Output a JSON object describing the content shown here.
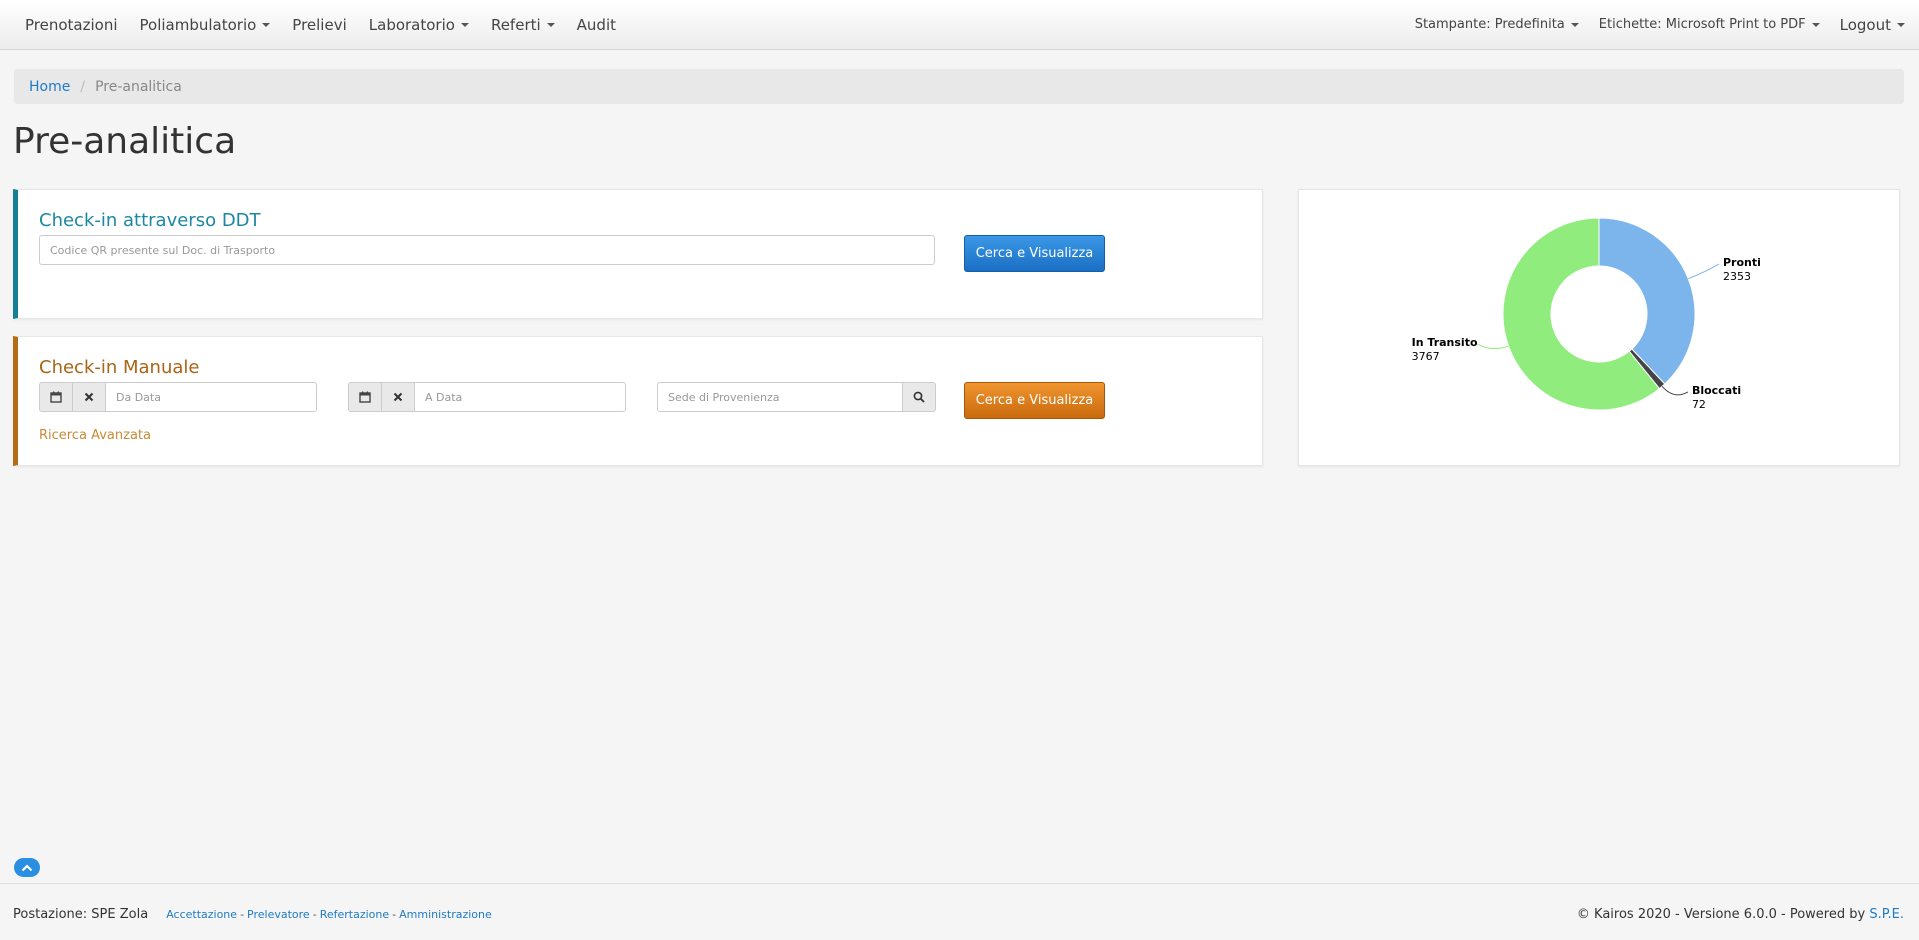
{
  "navbar": {
    "left": [
      {
        "label": "Prenotazioni",
        "dropdown": false
      },
      {
        "label": "Poliambulatorio",
        "dropdown": true
      },
      {
        "label": "Prelievi",
        "dropdown": false
      },
      {
        "label": "Laboratorio",
        "dropdown": true
      },
      {
        "label": "Referti",
        "dropdown": true
      },
      {
        "label": "Audit",
        "dropdown": false
      }
    ],
    "printer": "Stampante: Predefinita",
    "labels": "Etichette: Microsoft Print to PDF",
    "logout": "Logout"
  },
  "breadcrumb": {
    "home": "Home",
    "current": "Pre-analitica"
  },
  "page_title": "Pre-analitica",
  "ddt": {
    "title": "Check-in attraverso DDT",
    "placeholder": "Codice QR presente sul Doc. di Trasporto",
    "button": "Cerca e Visualizza"
  },
  "manual": {
    "title": "Check-in Manuale",
    "from_placeholder": "Da Data",
    "to_placeholder": "A Data",
    "sede_placeholder": "Sede di Provenienza",
    "button": "Cerca e Visualizza",
    "advanced": "Ricerca Avanzata",
    "icons": {
      "calendar": "calendar-icon",
      "clear": "times-icon",
      "search": "search-icon"
    }
  },
  "chart_data": {
    "type": "pie",
    "donut": true,
    "slices": [
      {
        "label": "Pronti",
        "value": 2353,
        "color": "#7cb5ec"
      },
      {
        "label": "Bloccati",
        "value": 72,
        "color": "#434348"
      },
      {
        "label": "In Transito",
        "value": 3767,
        "color": "#90ed7d"
      }
    ]
  },
  "footer": {
    "postazione": "Postazione: SPE Zola",
    "links": [
      "Accettazione",
      "Prelevatore",
      "Refertazione",
      "Amministrazione"
    ],
    "copyright": "© Kairos 2020 - Versione 6.0.0 - Powered by",
    "powered": "S.P.E."
  },
  "colors": {
    "accent_blue": "#1e7bc6",
    "ddt_border": "#177f93",
    "manual_border": "#b36d14"
  }
}
